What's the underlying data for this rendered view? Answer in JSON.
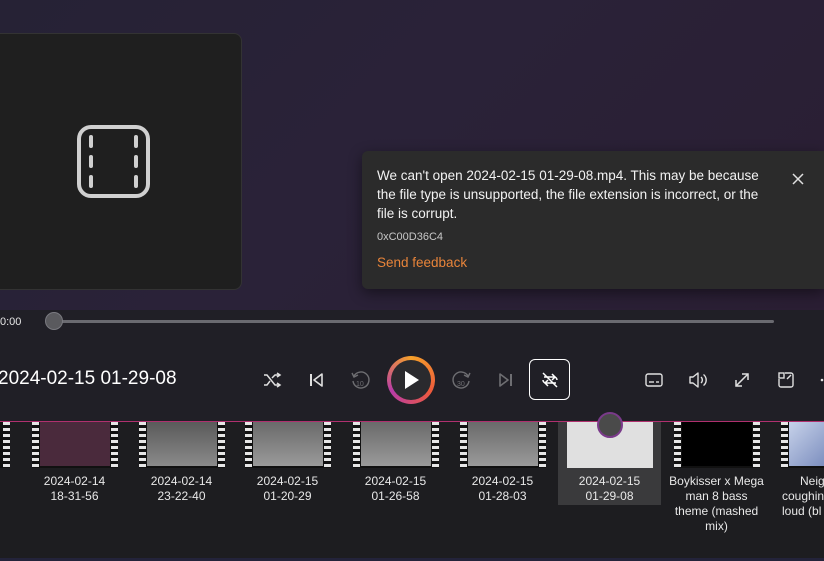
{
  "error_toast": {
    "message": "We can't open 2024-02-15 01-29-08.mp4. This may be because the file type is unsupported, the file extension is incorrect, or the file is corrupt.",
    "error_code": "0xC00D36C4",
    "feedback_link": "Send feedback"
  },
  "player": {
    "elapsed": "0:00",
    "progress": 0,
    "title": "2024-02-15 01-29-08",
    "skip_back_seconds": "10",
    "skip_forward_seconds": "30"
  },
  "playlist": [
    {
      "line1": "2024-02-14",
      "line2": "18-31-56",
      "line3": "",
      "line4": "",
      "thumb_color": "#4a2a3c"
    },
    {
      "line1": "2024-02-14",
      "line2": "23-22-40",
      "line3": "",
      "line4": "",
      "thumb_color": "#7a7a7a"
    },
    {
      "line1": "2024-02-15",
      "line2": "01-20-29",
      "line3": "",
      "line4": "",
      "thumb_color": "#8a8a8a"
    },
    {
      "line1": "2024-02-15",
      "line2": "01-26-58",
      "line3": "",
      "line4": "",
      "thumb_color": "#8a8a8a"
    },
    {
      "line1": "2024-02-15",
      "line2": "01-28-03",
      "line3": "",
      "line4": "",
      "thumb_color": "#8a8a8a"
    },
    {
      "line1": "2024-02-15",
      "line2": "01-29-08",
      "line3": "",
      "line4": "",
      "thumb_color": "#d8d8d8",
      "selected": true
    },
    {
      "line1": "Boykisser x Mega",
      "line2": "man 8 bass",
      "line3": "theme (mashed",
      "line4": "mix)",
      "thumb_color": "#000000"
    },
    {
      "line1": "Neig",
      "line2": "coughin",
      "line3": "loud (bl",
      "line4": "",
      "thumb_color": "#9fb2d8"
    }
  ]
}
